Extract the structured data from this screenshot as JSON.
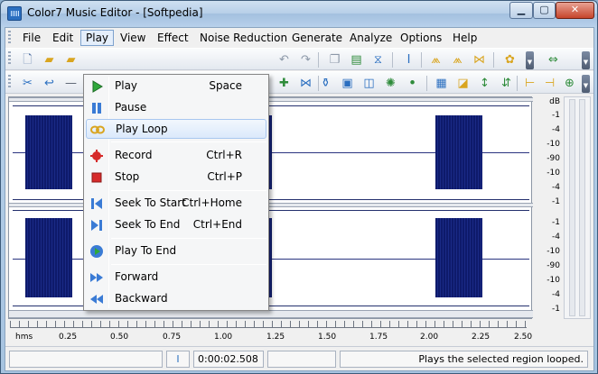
{
  "window": {
    "title": "Color7 Music Editor - [Softpedia]"
  },
  "menubar": {
    "items": [
      "File",
      "Edit",
      "Play",
      "View",
      "Effect",
      "Noise Reduction",
      "Generate",
      "Analyze",
      "Options",
      "Help"
    ],
    "active": "Play"
  },
  "play_menu": {
    "items": [
      {
        "label": "Play",
        "shortcut": "Space",
        "icon": "play-icon"
      },
      {
        "label": "Pause",
        "shortcut": "",
        "icon": "pause-icon"
      },
      {
        "label": "Play Loop",
        "shortcut": "",
        "icon": "loop-icon"
      },
      {
        "label": "Record",
        "shortcut": "Ctrl+R",
        "icon": "record-icon"
      },
      {
        "label": "Stop",
        "shortcut": "Ctrl+P",
        "icon": "stop-icon"
      },
      {
        "label": "Seek To Start",
        "shortcut": "Ctrl+Home",
        "icon": "seek-start-icon"
      },
      {
        "label": "Seek To End",
        "shortcut": "Ctrl+End",
        "icon": "seek-end-icon"
      },
      {
        "label": "Play To End",
        "shortcut": "",
        "icon": "play-to-end-icon"
      },
      {
        "label": "Forward",
        "shortcut": "",
        "icon": "forward-icon"
      },
      {
        "label": "Backward",
        "shortcut": "",
        "icon": "backward-icon"
      }
    ],
    "highlighted": "Play Loop"
  },
  "db_scale": {
    "unit": "dB",
    "top_channel": [
      "-1",
      "-4",
      "-10",
      "-90",
      "-10",
      "-4",
      "-1"
    ],
    "bottom_channel": [
      "-1",
      "-4",
      "-10",
      "-90",
      "-10",
      "-4",
      "-1"
    ]
  },
  "time_ruler": {
    "unit": "hms",
    "ticks": [
      "0.25",
      "0.50",
      "0.75",
      "1.00",
      "1.25",
      "1.50",
      "1.75",
      "2.00",
      "2.25",
      "2.50"
    ]
  },
  "statusbar": {
    "position": "0:00:02.508",
    "message": "Plays the selected region looped."
  },
  "colors": {
    "waveform": "#0e1a6b",
    "menu_highlight": "#dbe9fb"
  }
}
